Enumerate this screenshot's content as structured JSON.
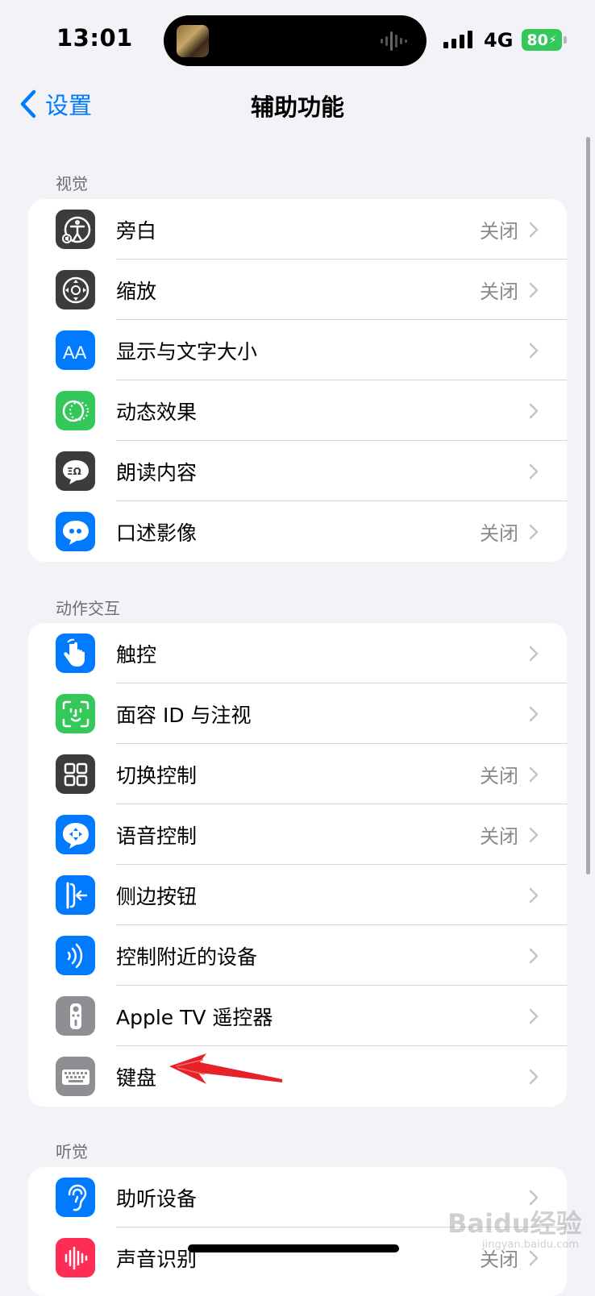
{
  "status": {
    "time": "13:01",
    "network": "4G",
    "battery": "80"
  },
  "nav": {
    "back_label": "设置",
    "title": "辅助功能"
  },
  "sections": [
    {
      "header": "视觉",
      "items": [
        {
          "label": "旁白",
          "value": "关闭",
          "icon": "voiceover-icon"
        },
        {
          "label": "缩放",
          "value": "关闭",
          "icon": "zoom-icon"
        },
        {
          "label": "显示与文字大小",
          "value": "",
          "icon": "text-size-icon"
        },
        {
          "label": "动态效果",
          "value": "",
          "icon": "motion-icon"
        },
        {
          "label": "朗读内容",
          "value": "",
          "icon": "spoken-content-icon"
        },
        {
          "label": "口述影像",
          "value": "关闭",
          "icon": "audio-description-icon"
        }
      ]
    },
    {
      "header": "动作交互",
      "items": [
        {
          "label": "触控",
          "value": "",
          "icon": "touch-icon"
        },
        {
          "label": "面容 ID 与注视",
          "value": "",
          "icon": "face-id-icon"
        },
        {
          "label": "切换控制",
          "value": "关闭",
          "icon": "switch-control-icon"
        },
        {
          "label": "语音控制",
          "value": "关闭",
          "icon": "voice-control-icon"
        },
        {
          "label": "侧边按钮",
          "value": "",
          "icon": "side-button-icon"
        },
        {
          "label": "控制附近的设备",
          "value": "",
          "icon": "nearby-devices-icon"
        },
        {
          "label": "Apple TV 遥控器",
          "value": "",
          "icon": "remote-icon"
        },
        {
          "label": "键盘",
          "value": "",
          "icon": "keyboard-icon"
        }
      ]
    },
    {
      "header": "听觉",
      "items": [
        {
          "label": "助听设备",
          "value": "",
          "icon": "hearing-devices-icon"
        },
        {
          "label": "声音识别",
          "value": "关闭",
          "icon": "sound-recognition-icon"
        }
      ]
    }
  ],
  "watermark": {
    "text": "Baidu经验",
    "sub": "jingyan.baidu.com"
  }
}
